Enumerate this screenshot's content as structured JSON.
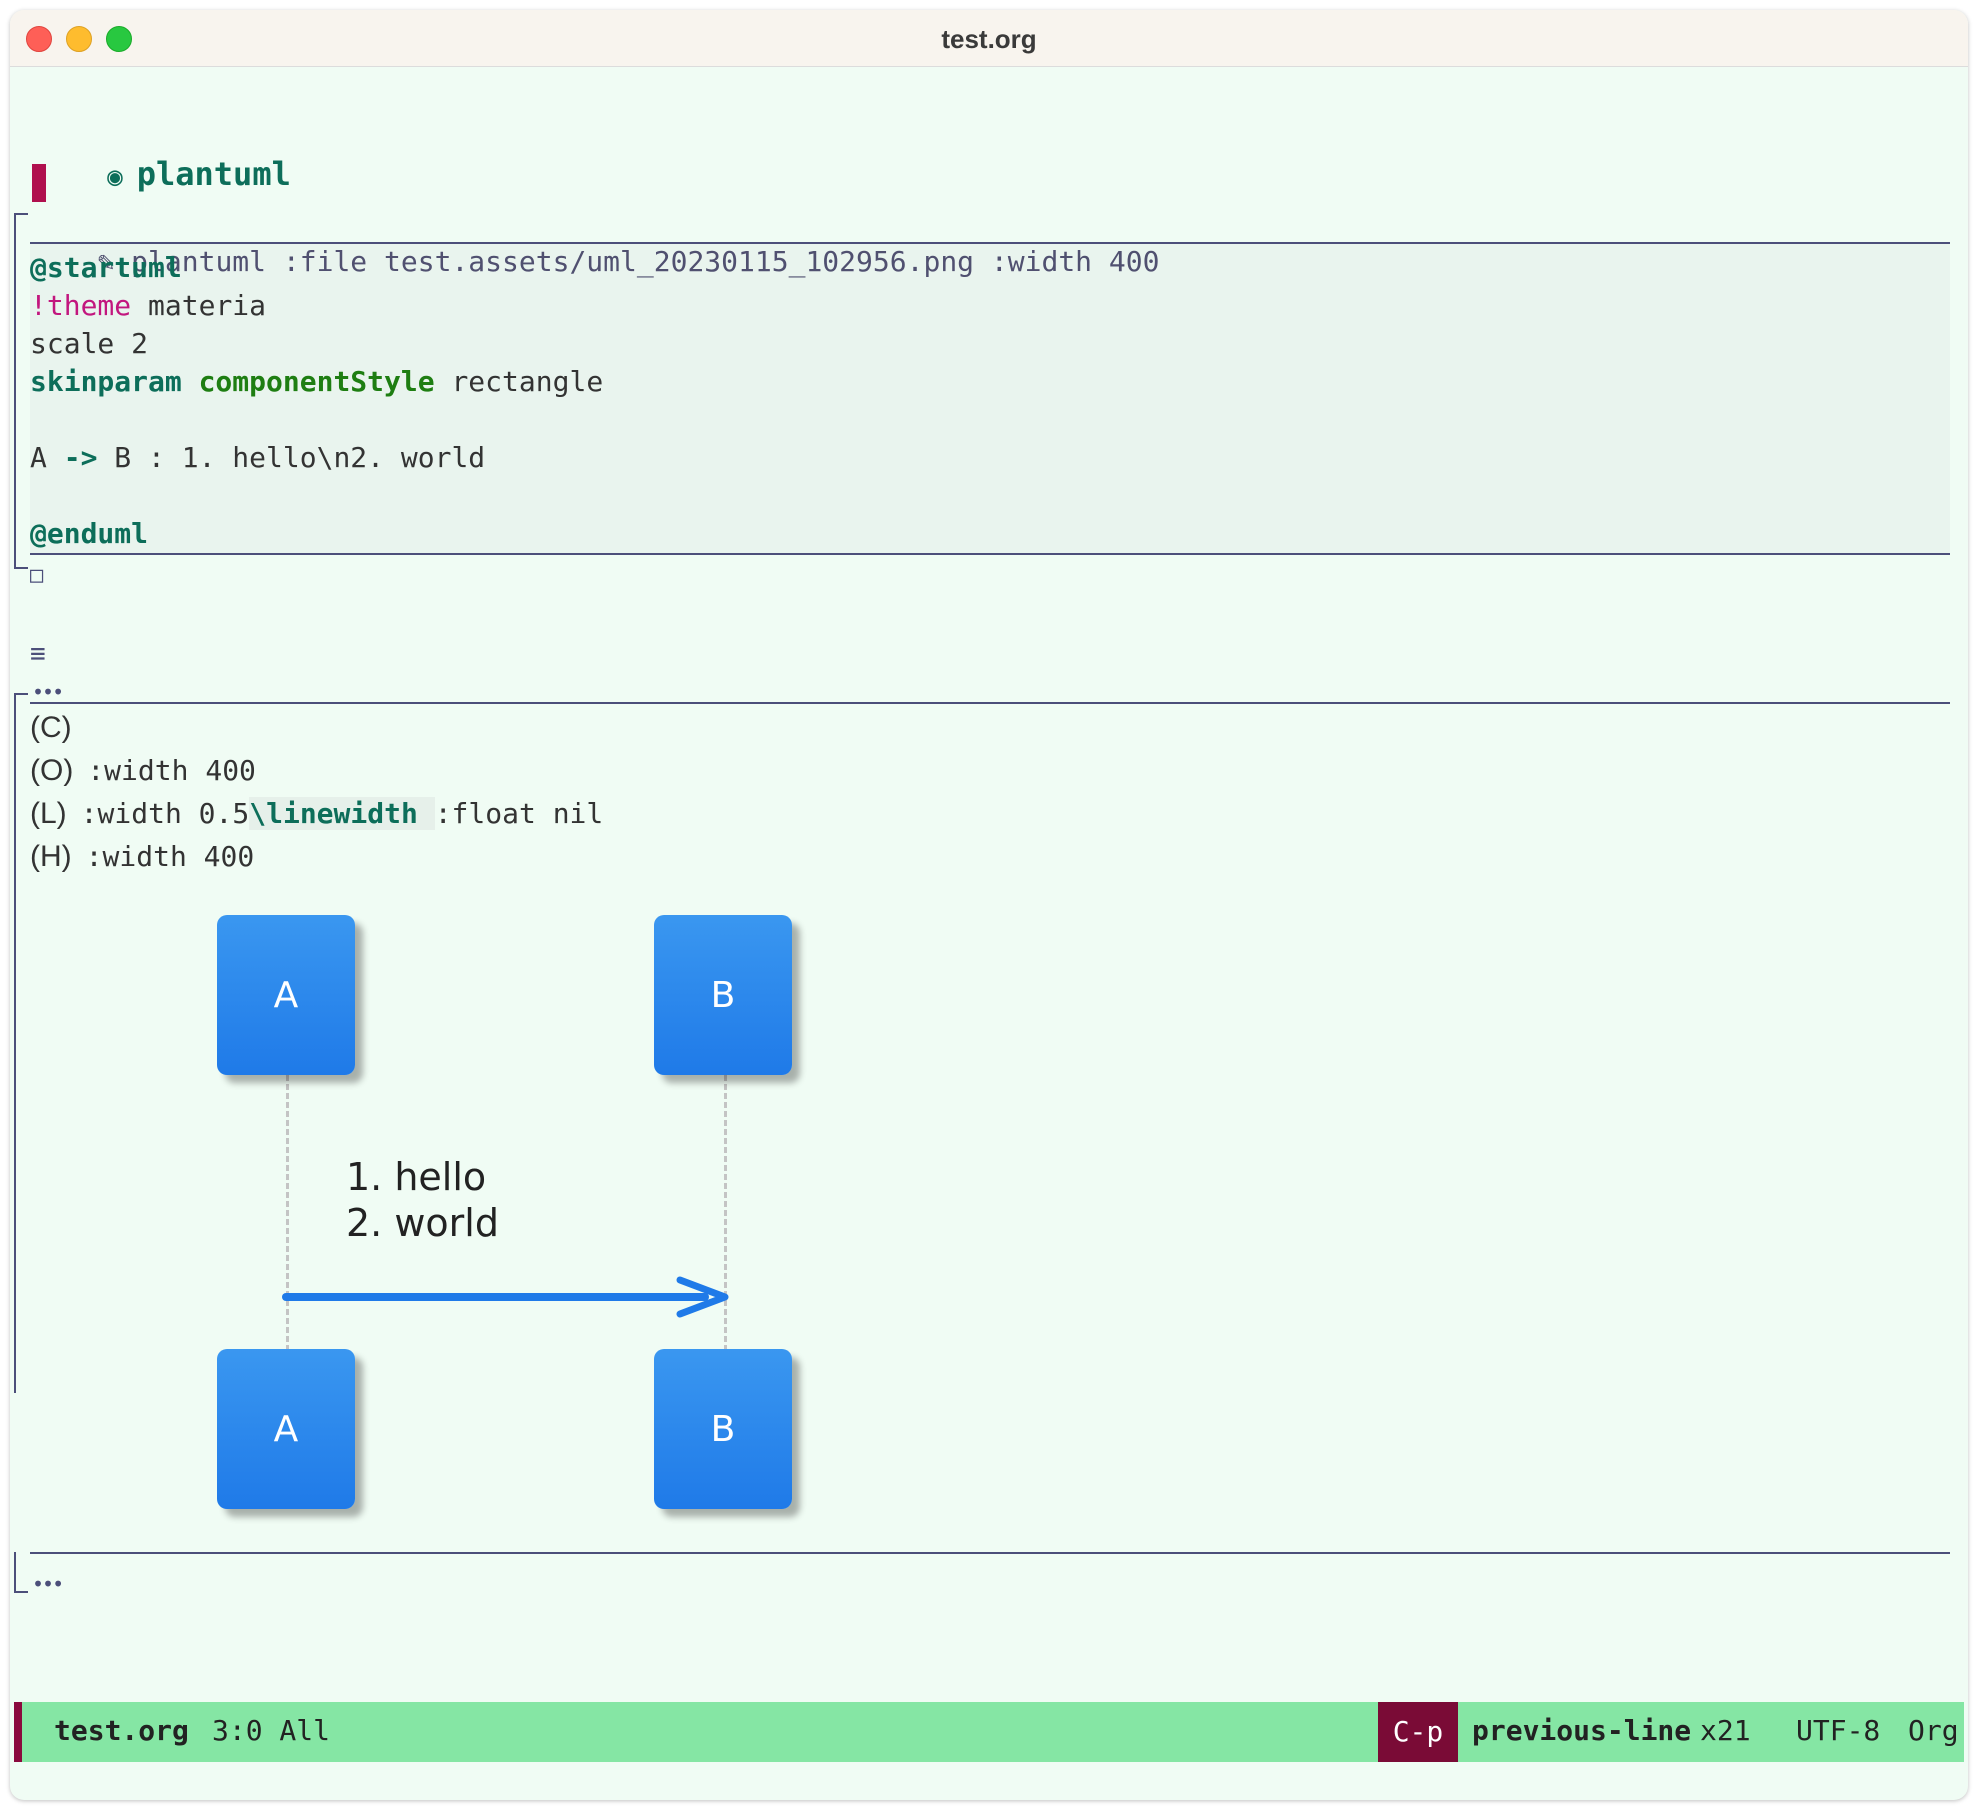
{
  "window": {
    "title": "test.org"
  },
  "heading": {
    "bullet": "◉",
    "text": "plantuml"
  },
  "src_block": {
    "begin_icon": "✎",
    "begin_line": "plantuml :file test.assets/uml_20230115_102956.png :width 400",
    "lines": {
      "startuml": "@startuml",
      "theme_kw": "!theme",
      "theme_val": "materia",
      "scale": "scale 2",
      "skinparam_kw": "skinparam",
      "skinparam_attr": "componentStyle",
      "skinparam_val": "rectangle",
      "a": "A ",
      "arrow": "->",
      "rest": " B : 1. hello\\n2. world",
      "enduml": "@enduml"
    },
    "end_marker": "□"
  },
  "results": {
    "marker": "≡",
    "open_ellipsis": "•••",
    "close_ellipsis": "•••",
    "attrs": {
      "c_tag": "(C)",
      "o_tag": "(O)",
      "o_val": ":width 400",
      "l_tag": "(L)",
      "l_pre": ":width 0.5",
      "l_cmd": "\\linewidth ",
      "l_post": ":float nil",
      "h_tag": "(H)",
      "h_val": ":width 400"
    }
  },
  "diagram": {
    "participant_a": "A",
    "participant_b": "B",
    "message_line1": "1. hello",
    "message_line2": "2. world",
    "colors": {
      "participant": "#2384ec",
      "arrow": "#1f7ae8"
    }
  },
  "modeline": {
    "buffer": "test.org",
    "position": "3:0 All",
    "key": "C-p",
    "command": "previous-line",
    "repeat": "x21",
    "encoding": "UTF-8",
    "mode": "Org"
  }
}
